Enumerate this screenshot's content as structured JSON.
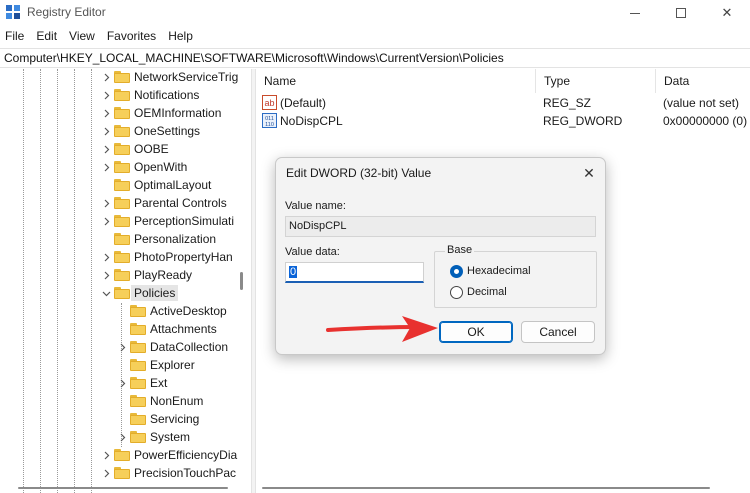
{
  "window": {
    "title": "Registry Editor",
    "icon": "registry-editor-icon",
    "controls": {
      "minimize": "minimize-icon",
      "maximize": "maximize-icon",
      "close": "✕"
    }
  },
  "menu": [
    "File",
    "Edit",
    "View",
    "Favorites",
    "Help"
  ],
  "address": "Computer\\HKEY_LOCAL_MACHINE\\SOFTWARE\\Microsoft\\Windows\\CurrentVersion\\Policies",
  "tree": [
    {
      "label": "NetworkServiceTrig",
      "expander": "chevron-right"
    },
    {
      "label": "Notifications",
      "expander": "chevron-right"
    },
    {
      "label": "OEMInformation",
      "expander": "chevron-right"
    },
    {
      "label": "OneSettings",
      "expander": "chevron-right"
    },
    {
      "label": "OOBE",
      "expander": "chevron-right"
    },
    {
      "label": "OpenWith",
      "expander": "chevron-right"
    },
    {
      "label": "OptimalLayout",
      "expander": "none"
    },
    {
      "label": "Parental Controls",
      "expander": "chevron-right"
    },
    {
      "label": "PerceptionSimulati",
      "expander": "chevron-right"
    },
    {
      "label": "Personalization",
      "expander": "none"
    },
    {
      "label": "PhotoPropertyHan",
      "expander": "chevron-right"
    },
    {
      "label": "PlayReady",
      "expander": "chevron-right"
    },
    {
      "label": "Policies",
      "expander": "chevron-down",
      "selected": true
    },
    {
      "label": "ActiveDesktop",
      "expander": "none",
      "child": true
    },
    {
      "label": "Attachments",
      "expander": "none",
      "child": true
    },
    {
      "label": "DataCollection",
      "expander": "chevron-right",
      "child": true
    },
    {
      "label": "Explorer",
      "expander": "none",
      "child": true
    },
    {
      "label": "Ext",
      "expander": "chevron-right",
      "child": true
    },
    {
      "label": "NonEnum",
      "expander": "none",
      "child": true
    },
    {
      "label": "Servicing",
      "expander": "none",
      "child": true
    },
    {
      "label": "System",
      "expander": "chevron-right",
      "child": true
    },
    {
      "label": "PowerEfficiencyDia",
      "expander": "chevron-right"
    },
    {
      "label": "PrecisionTouchPac",
      "expander": "chevron-right"
    }
  ],
  "list": {
    "headers": {
      "name": "Name",
      "type": "Type",
      "data": "Data"
    },
    "rows": [
      {
        "icon": "string-value-icon",
        "icon_text": "ab",
        "name": "(Default)",
        "type": "REG_SZ",
        "data": "(value not set)"
      },
      {
        "icon": "dword-value-icon",
        "icon_text": "011",
        "name": "NoDispCPL",
        "type": "REG_DWORD",
        "data": "0x00000000 (0)"
      }
    ]
  },
  "dialog": {
    "title": "Edit DWORD (32-bit) Value",
    "close": "✕",
    "value_name_label": "Value name:",
    "value_name": "NoDispCPL",
    "value_data_label": "Value data:",
    "value_data": "0",
    "base_label": "Base",
    "base_options": [
      {
        "label": "Hexadecimal",
        "checked": true
      },
      {
        "label": "Decimal",
        "checked": false
      }
    ],
    "ok": "OK",
    "cancel": "Cancel"
  },
  "colors": {
    "accent": "#0067c0",
    "arrow": "#e8312f",
    "folder": "#f6cf5a"
  }
}
